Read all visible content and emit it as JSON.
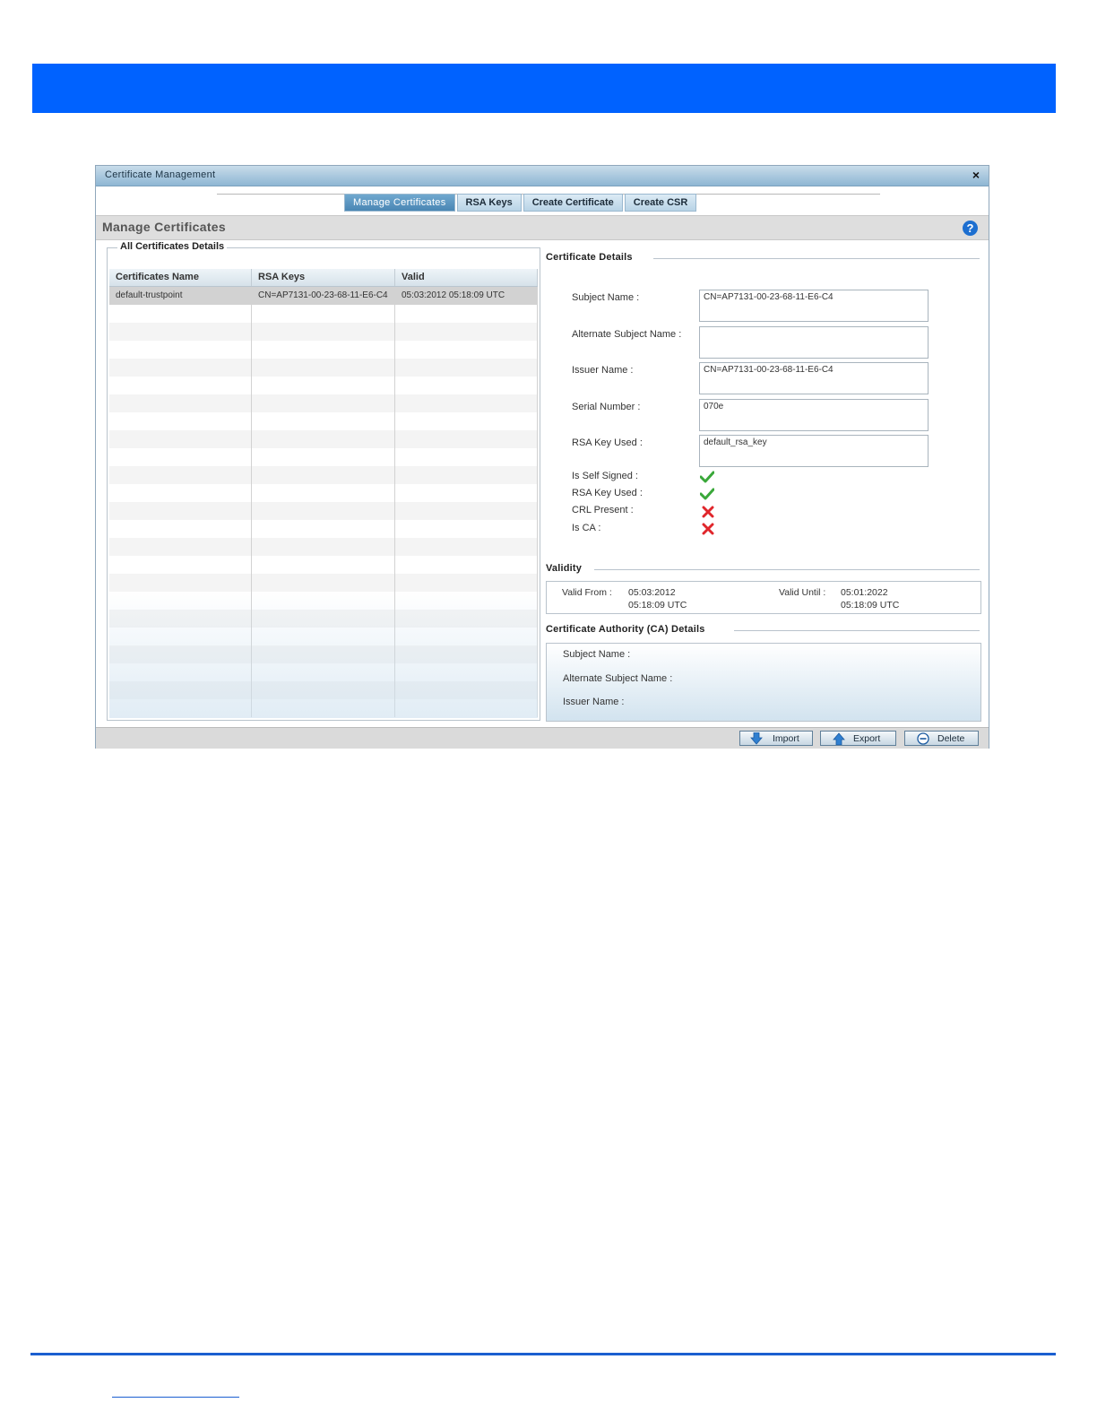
{
  "window": {
    "title": "Certificate Management",
    "close_label": "×"
  },
  "tabs": [
    {
      "label": "Manage Certificates",
      "active": true
    },
    {
      "label": "RSA Keys",
      "active": false
    },
    {
      "label": "Create Certificate",
      "active": false
    },
    {
      "label": "Create CSR",
      "active": false
    }
  ],
  "page_header": {
    "title": "Manage Certificates",
    "help_label": "?"
  },
  "certificates_panel": {
    "legend": "All Certificates Details",
    "columns": [
      "Certificates Name",
      "RSA Keys",
      "Valid"
    ],
    "rows": [
      {
        "name": "default-trustpoint",
        "rsa_keys": "CN=AP7131-00-23-68-11-E6-C4",
        "valid": "05:03:2012 05:18:09 UTC"
      }
    ]
  },
  "certificate_details": {
    "title": "Certificate Details",
    "subject_name_label": "Subject Name :",
    "subject_name_value": "CN=AP7131-00-23-68-11-E6-C4",
    "alt_subject_name_label": "Alternate Subject Name :",
    "alt_subject_name_value": "",
    "issuer_name_label": "Issuer Name :",
    "issuer_name_value": "CN=AP7131-00-23-68-11-E6-C4",
    "serial_number_label": "Serial Number :",
    "serial_number_value": "070e",
    "rsa_key_used_label": "RSA Key Used :",
    "rsa_key_used_value": "default_rsa_key",
    "flags": [
      {
        "label": "Is Self Signed :",
        "icon": "check-icon",
        "value": true
      },
      {
        "label": "RSA Key Used :",
        "icon": "check-icon",
        "value": true
      },
      {
        "label": "CRL Present :",
        "icon": "x-icon",
        "value": false
      },
      {
        "label": "Is CA :",
        "icon": "x-icon",
        "value": false
      }
    ]
  },
  "validity": {
    "title": "Validity",
    "valid_from_label": "Valid From :",
    "valid_from_date": "05:03:2012",
    "valid_from_time": "05:18:09 UTC",
    "valid_until_label": "Valid Until :",
    "valid_until_date": "05:01:2022",
    "valid_until_time": "05:18:09 UTC"
  },
  "ca_details": {
    "title": "Certificate Authority (CA) Details",
    "subject_name_label": "Subject Name :",
    "alt_subject_name_label": "Alternate Subject Name :",
    "issuer_name_label": "Issuer Name :"
  },
  "buttons": {
    "import": "Import",
    "export": "Export",
    "delete": "Delete"
  },
  "colors": {
    "banner": "#0062ff",
    "check": "#3aa83a",
    "cross": "#e0262b",
    "help": "#1d6fd0"
  }
}
